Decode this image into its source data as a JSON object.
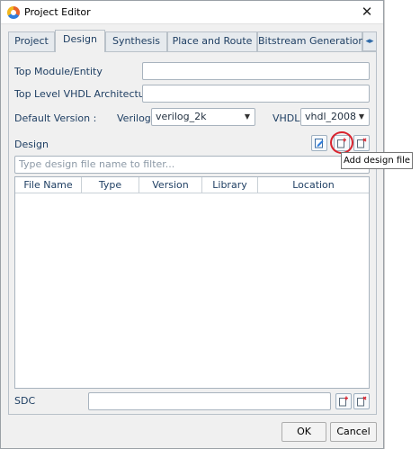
{
  "window": {
    "title": "Project Editor",
    "close": "✕"
  },
  "tabs": [
    {
      "label": "Project"
    },
    {
      "label": "Design"
    },
    {
      "label": "Synthesis"
    },
    {
      "label": "Place and Route"
    },
    {
      "label": "Bitstream Generation"
    }
  ],
  "active_tab": "Design",
  "tab_scroll": "◂▸",
  "form": {
    "top_module_label": "Top Module/Entity",
    "top_module_value": "",
    "top_vhdl_label": "Top Level VHDL Architecture",
    "top_vhdl_value": "",
    "default_version_label": "Default Version :",
    "verilog_label": "Verilog",
    "verilog_value": "verilog_2k",
    "vhdl_label": "VHDL",
    "vhdl_value": "vhdl_2008",
    "combo_arrow": "▼"
  },
  "design": {
    "label": "Design",
    "filter_placeholder": "Type design file name to filter...",
    "buttons": [
      {
        "name": "edit-design-file",
        "icon": "edit-file-icon"
      },
      {
        "name": "add-design-file",
        "icon": "add-file-icon"
      },
      {
        "name": "remove-design-file",
        "icon": "remove-file-icon"
      }
    ],
    "tooltip": "Add design file",
    "columns": [
      "File Name",
      "Type",
      "Version",
      "Library",
      "Location"
    ],
    "rows": []
  },
  "sdc": {
    "label": "SDC",
    "value": ""
  },
  "footer": {
    "ok_label": "OK",
    "cancel_label": "Cancel"
  },
  "colors": {
    "highlight": "#d9232e",
    "label_text": "#1f3f63",
    "accent": "#2f7ddc"
  }
}
